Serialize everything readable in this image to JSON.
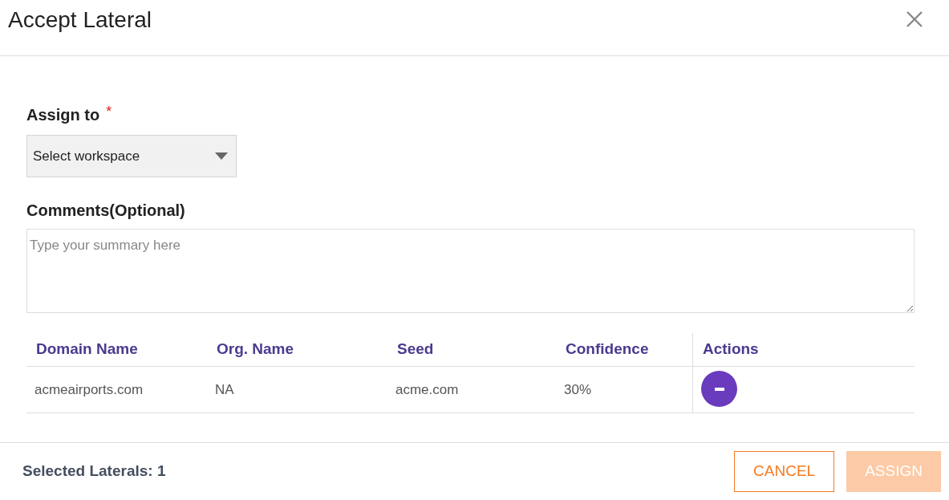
{
  "dialog": {
    "title": "Accept Lateral"
  },
  "assign_field": {
    "label": "Assign to",
    "required_mark": "*",
    "value": "Select workspace"
  },
  "comments_field": {
    "label": "Comments(Optional)",
    "placeholder": "Type your summary here"
  },
  "table": {
    "columns": [
      "Domain Name",
      "Org. Name",
      "Seed",
      "Confidence",
      "Actions"
    ],
    "rows": [
      {
        "cells": [
          "acmeairports.com",
          "NA",
          "acme.com",
          "30%"
        ]
      }
    ]
  },
  "footer": {
    "status": "Selected Laterals: 1",
    "buttons": [
      {
        "label": "CANCEL",
        "kind": "secondary",
        "disabled": false
      },
      {
        "label": "ASSIGN",
        "kind": "primary",
        "disabled": true
      }
    ]
  }
}
